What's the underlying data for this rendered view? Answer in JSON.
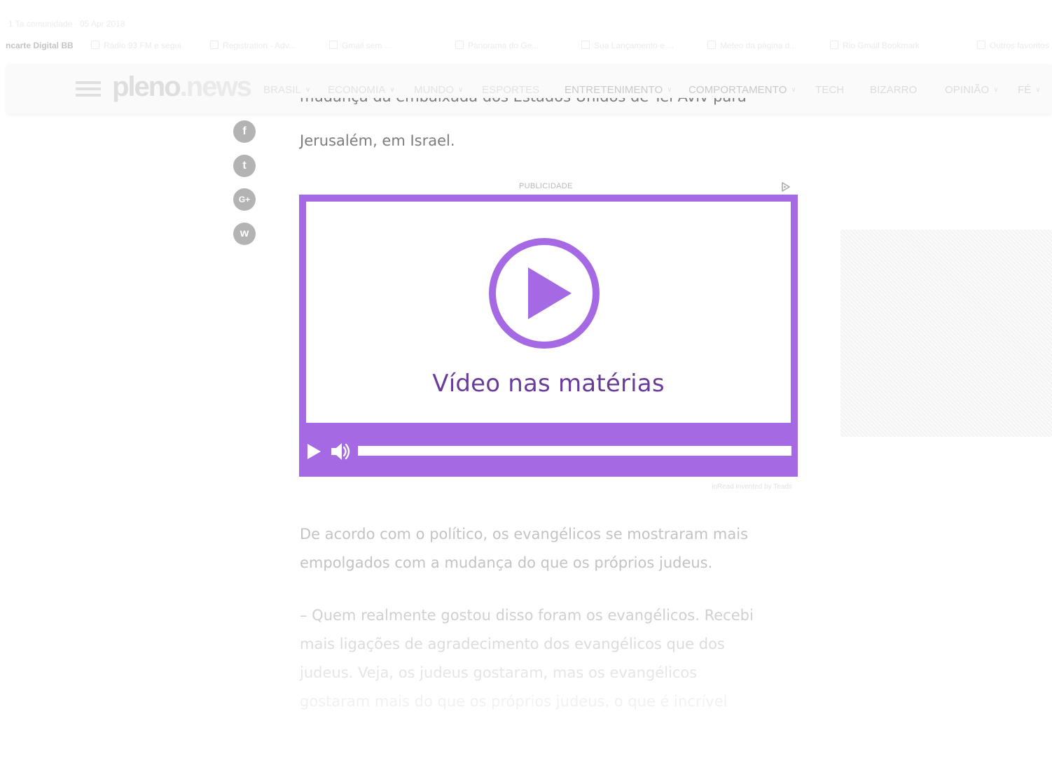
{
  "browser": {
    "tab_title": "1 Ta comunidade · 05 Apr 2018",
    "bookmarks": [
      {
        "label": "ncarte Digital BB"
      },
      {
        "label": "Rádio 93 FM e segui"
      },
      {
        "label": "Registration - Adv..."
      },
      {
        "label": "Gmail sem ..."
      },
      {
        "label": "Panorama do Ge..."
      },
      {
        "label": "Sua Lançamento e ..."
      },
      {
        "label": "Meteo da página d..."
      },
      {
        "label": "Rio Gmail Bookmark"
      },
      {
        "label": "Outros favoritos"
      }
    ]
  },
  "navbar": {
    "logo_part1": "pleno",
    "logo_part2": ".news",
    "items": [
      {
        "label": "BRASIL",
        "has_dropdown": true,
        "color": "#e3e3e3"
      },
      {
        "label": "ECONOMIA",
        "has_dropdown": true,
        "color": "#e3e3e3"
      },
      {
        "label": "MUNDO",
        "has_dropdown": true,
        "color": "#e3e3e3"
      },
      {
        "label": "ESPORTES",
        "has_dropdown": false,
        "color": "#e3e3e3"
      },
      {
        "label": "ENTRETENIMENTO",
        "has_dropdown": true,
        "color": "#c9c9c9"
      },
      {
        "label": "COMPORTAMENTO",
        "has_dropdown": true,
        "color": "#c9c9c9"
      },
      {
        "label": "TECH",
        "has_dropdown": false,
        "color": "#dcdcdc"
      },
      {
        "label": "BIZARRO",
        "has_dropdown": false,
        "color": "#dcdcdc"
      },
      {
        "label": "OPINIÃO",
        "has_dropdown": true,
        "color": "#dcdcdc"
      },
      {
        "label": "FÉ",
        "has_dropdown": true,
        "color": "#dcdcdc"
      }
    ]
  },
  "share": [
    {
      "network": "facebook",
      "glyph": "f"
    },
    {
      "network": "twitter",
      "glyph": "t"
    },
    {
      "network": "google-plus",
      "glyph": "G+"
    },
    {
      "network": "whatsapp",
      "glyph": "w"
    }
  ],
  "article": {
    "para_top_cut": "mudança da embaixada dos Estados Unidos de Tel Aviv para",
    "para_top": "Jerusalém, em Israel.",
    "para_2": [
      "De acordo com o político, os evangélicos se mostraram mais",
      "empolgados com a mudança do que os próprios judeus."
    ],
    "para_3": [
      "– Quem realmente gostou disso foram os evangélicos. Recebi",
      "mais ligações de agradecimento dos evangélicos que dos",
      "judeus. Veja, os judeus gostaram, mas os evangélicos",
      "gostaram mais do que os próprios judeus, o que é incrível"
    ]
  },
  "video_ad": {
    "label": "PUBLICIDADE",
    "title": "Vídeo nas matérias",
    "progress": 0,
    "credit": "inRead invented by Teads",
    "accent_color": "#a56ae3",
    "title_color": "#6a3c99"
  },
  "colors": {
    "accent": "#a56ae3",
    "share_icon": "#b3b3b3"
  }
}
